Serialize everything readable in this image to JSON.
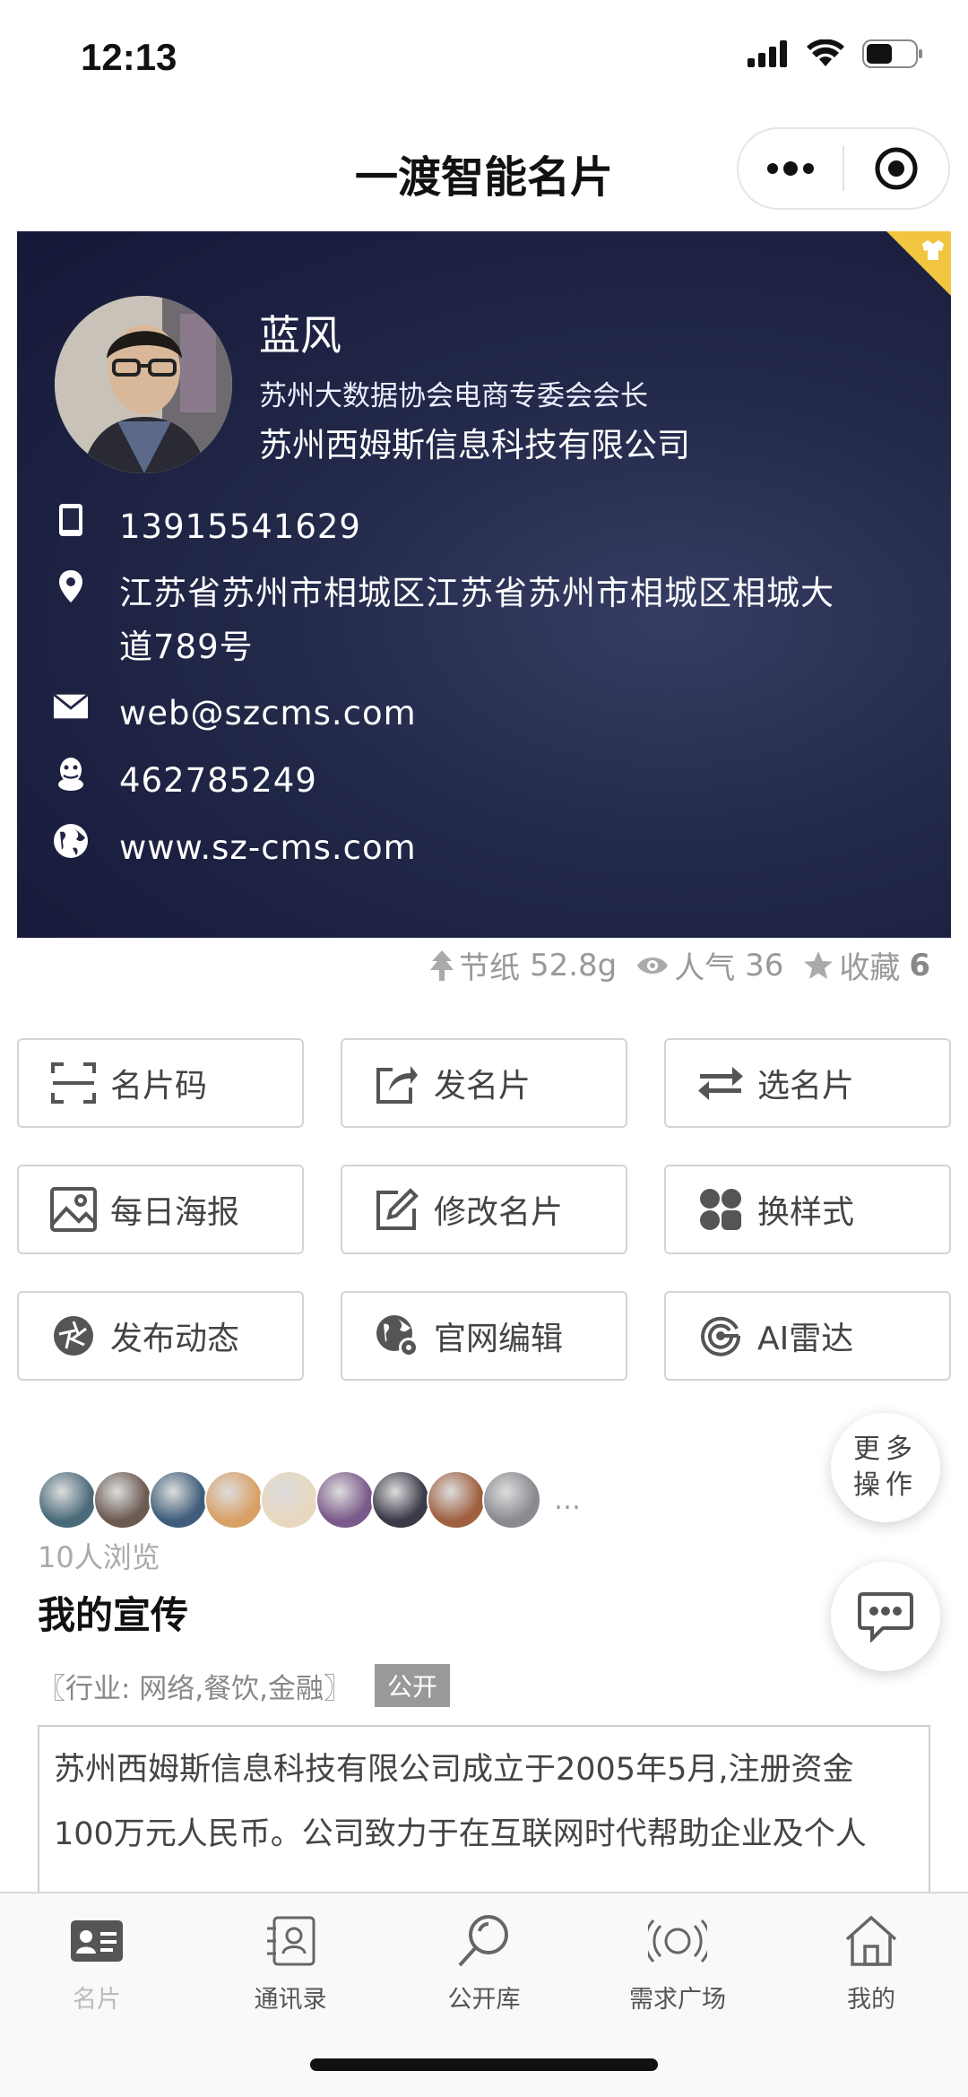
{
  "status_bar": {
    "time": "12:13",
    "icons": [
      "signal-icon",
      "wifi-icon",
      "battery-icon"
    ]
  },
  "navbar": {
    "title": "一渡智能名片",
    "icons": [
      "more-dots-icon",
      "target-icon"
    ]
  },
  "card": {
    "name": "蓝风",
    "position": "苏州大数据协会电商专委会会长",
    "company": "苏州西姆斯信息科技有限公司",
    "phone": "13915541629",
    "address_line1": "江苏省苏州市相城区江苏省苏州市相城区相城大",
    "address_line2": "道789号",
    "email": "web@szcms.com",
    "qq": "462785249",
    "website": "www.sz-cms.com",
    "icons": [
      "phone-icon",
      "location-icon",
      "mail-icon",
      "qq-icon",
      "globe-icon",
      "shirt-icon"
    ]
  },
  "stats": {
    "paper_label": "节纸",
    "paper_value": "52.8g",
    "views_label": "人气",
    "views_value": "36",
    "fav_label": "收藏",
    "fav_value": "6"
  },
  "actions": [
    {
      "label": "名片码",
      "icon": "scan-icon"
    },
    {
      "label": "发名片",
      "icon": "share-icon"
    },
    {
      "label": "选名片",
      "icon": "swap-icon"
    },
    {
      "label": "每日海报",
      "icon": "image-icon"
    },
    {
      "label": "修改名片",
      "icon": "edit-icon"
    },
    {
      "label": "换样式",
      "icon": "style-icon"
    },
    {
      "label": "发布动态",
      "icon": "aperture-icon"
    },
    {
      "label": "官网编辑",
      "icon": "globe-gear-icon"
    },
    {
      "label": "AI雷达",
      "icon": "radar-icon"
    }
  ],
  "floating": {
    "more_line1": "更多",
    "more_line2": "操作",
    "chat_icon": "chat-icon"
  },
  "visitors": {
    "avatar_colors": [
      "#4a6a7a",
      "#6b5a50",
      "#3f5d7a",
      "#d9a066",
      "#e8d8c0",
      "#7a5a8a",
      "#3a3a48",
      "#a06040",
      "#8a8a90"
    ],
    "ellipsis": "…",
    "count_text": "10人浏览"
  },
  "promo": {
    "title": "我的宣传",
    "industry": "〖行业: 网络,餐饮,金融〗",
    "badge": "公开",
    "desc_line1": "苏州西姆斯信息科技有限公司成立于2005年5月,注册资金",
    "desc_line2": "100万元人民币。公司致力于在互联网时代帮助企业及个人"
  },
  "tabbar": [
    {
      "label": "名片",
      "icon": "card-icon",
      "active": true
    },
    {
      "label": "通讯录",
      "icon": "contacts-icon",
      "active": false
    },
    {
      "label": "公开库",
      "icon": "search-icon",
      "active": false
    },
    {
      "label": "需求广场",
      "icon": "broadcast-icon",
      "active": false
    },
    {
      "label": "我的",
      "icon": "home-icon",
      "active": false
    }
  ]
}
